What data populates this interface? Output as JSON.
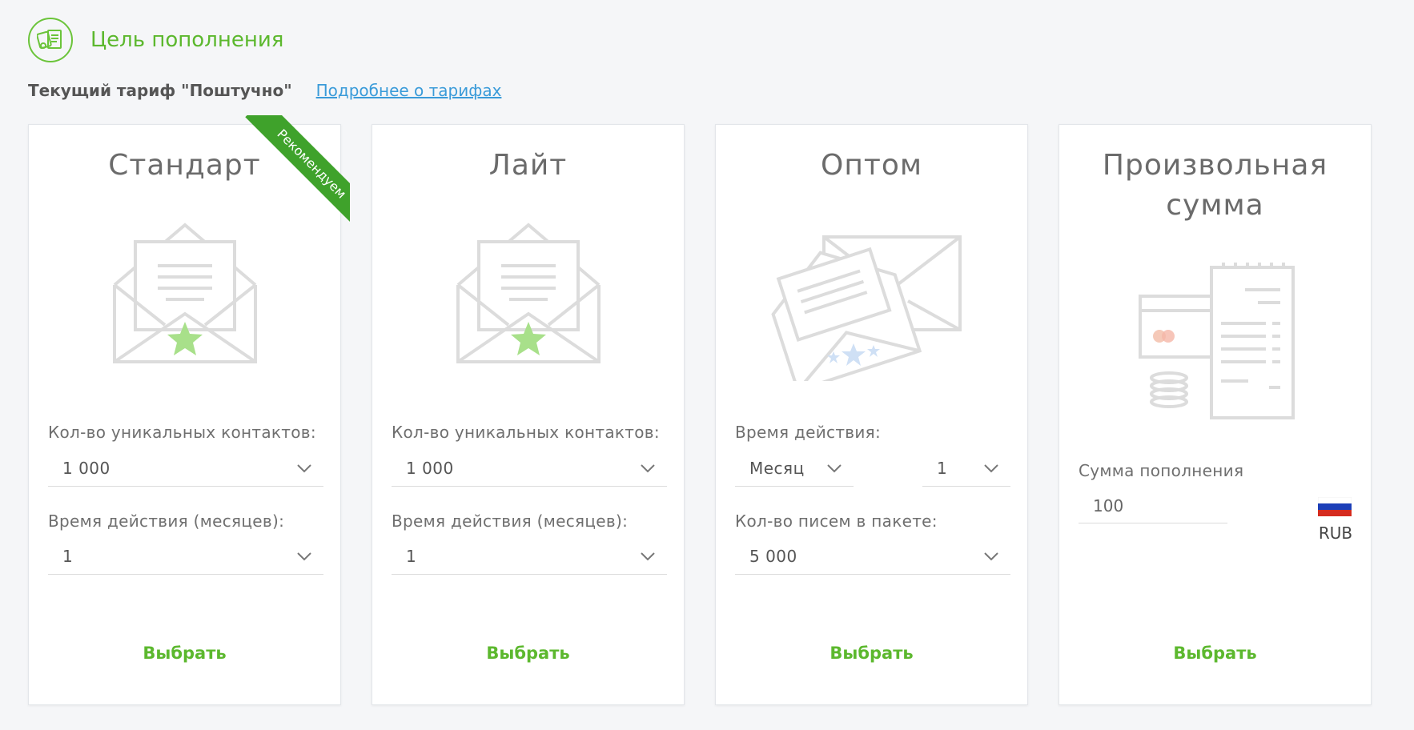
{
  "header": {
    "title": "Цель пополнения",
    "icon": "wallet-receipt-icon",
    "accent_color": "#5cb82e"
  },
  "tariff": {
    "current": "Текущий тариф \"Поштучно\"",
    "link": "Подробнее о тарифах"
  },
  "cards": [
    {
      "title": "Стандарт",
      "badge": "Рекомендуем",
      "illustration": "envelope-star-icon",
      "field1_label": "Кол-во уникальных контактов:",
      "field1_value": "1 000",
      "field2_label": "Время действия (месяцев):",
      "field2_value": "1",
      "button": "Выбрать"
    },
    {
      "title": "Лайт",
      "illustration": "envelope-star-icon",
      "field1_label": "Кол-во уникальных контактов:",
      "field1_value": "1 000",
      "field2_label": "Время действия (месяцев):",
      "field2_value": "1",
      "button": "Выбрать"
    },
    {
      "title": "Оптом",
      "illustration": "envelopes-stars-icon",
      "field1_label": "Время действия:",
      "period_unit": "Месяц",
      "period_count": "1",
      "field2_label": "Кол-во писем в пакете:",
      "field2_value": "5 000",
      "button": "Выбрать"
    },
    {
      "title_line1": "Произвольная",
      "title_line2": "сумма",
      "illustration": "card-receipt-coins-icon",
      "amount_label": "Сумма пополнения",
      "amount_value": "100",
      "currency": "RUB",
      "currency_icon": "russia-flag-icon",
      "button": "Выбрать"
    }
  ]
}
